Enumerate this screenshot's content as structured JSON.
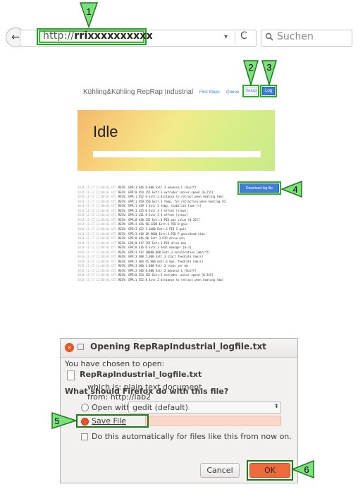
{
  "browser": {
    "url_prefix": "http://",
    "url_host": "rrixxxxxxxxxx",
    "search_placeholder": "Suchen",
    "back_glyph": "←",
    "forward_glyph": "⓪",
    "dropdown_glyph": "▾",
    "reload_glyph": "C",
    "search_glyph": "🔍"
  },
  "app": {
    "brand": "Kühling&Kühling RepRap Industrial",
    "nav": {
      "first_steps": "First Steps",
      "queue": "Queue",
      "setup": "Setup",
      "log": "Log"
    },
    "status": "Idle",
    "download_button": "Download log file",
    "log_lines": [
      {
        "ts": "2014-11-17 12:00:01 UTC",
        "msg": "RECV: EPR:3 446 8.000 Extr.3 advance L [0=off]"
      },
      {
        "ts": "2014-11-17 12:00:01 UTC",
        "msg": "RECV: EPR:0 454 255 Extr.3 extruder cooler speed [0-255]"
      },
      {
        "ts": "2014-11-17 12:00:01 UTC",
        "msg": "RECV: EPR:1 452 8 Extr.3 distance to retract when heating [mm]"
      },
      {
        "ts": "2014-11-17 12:00:01 UTC",
        "msg": "RECV: EPR:1 450 150 Extr.3 temp. for retraction when heating [C]"
      },
      {
        "ts": "2014-11-17 12:00:01 UTC",
        "msg": "RECV: EPR:1 439 1 Extr.3 temp. stabilize time [s]"
      },
      {
        "ts": "2014-11-17 12:00:01 UTC",
        "msg": "RECV: EPR:1 435 0 Extr.3 Y-offset [steps]"
      },
      {
        "ts": "2014-11-17 12:00:01 UTC",
        "msg": "RECV: EPR:1 431 0 Extr.3 X-offset [steps]"
      },
      {
        "ts": "2014-11-17 12:00:01 UTC",
        "msg": "RECV: EPR:0 430 255 Extr.3 PID max value [0-255]"
      },
      {
        "ts": "2014-11-17 12:00:01 UTC",
        "msg": "RECV: EPR:3 426 50.3200 Extr.3 PID D-gain"
      },
      {
        "ts": "2014-11-17 12:00:01 UTC",
        "msg": "RECV: EPR:3 422 1.6400 Extr.3 PID I-gain"
      },
      {
        "ts": "2014-11-17 12:00:01 UTC",
        "msg": "RECV: EPR:3 418 19.9600 Extr.3 PID P-gain/dead-time"
      },
      {
        "ts": "2014-11-17 12:00:01 UTC",
        "msg": "RECV: EPR:0 446 60 Extr.3 PID drive min"
      },
      {
        "ts": "2014-11-17 12:00:01 UTC",
        "msg": "RECV: EPR:0 417 255 Extr.3 PID drive max"
      },
      {
        "ts": "2014-11-17 12:00:01 UTC",
        "msg": "RECV: EPR:0 416 0 Extr.3 heat manager [0-3]"
      },
      {
        "ts": "2014-11-17 12:00:01 UTC",
        "msg": "RECV: EPR:3 412 10000.000 Extr.3 acceleration [mm/s^2]"
      },
      {
        "ts": "2014-11-17 12:00:01 UTC",
        "msg": "RECV: EPR:3 408 5.000 Extr.3 start feedrate [mm/s]"
      },
      {
        "ts": "2014-11-17 12:00:01 UTC",
        "msg": "RECV: EPR:3 404 45.000 Extr.3 max. feedrate [mm/s]"
      },
      {
        "ts": "2014-11-17 12:00:01 UTC",
        "msg": "RECV: EPR:3 400 1.000 Extr.3 steps per mm"
      },
      {
        "ts": "2014-11-17 12:00:01 UTC",
        "msg": "RECV: EPR:3 346 8.000 Extr.2 advance L [0=off]"
      },
      {
        "ts": "2014-11-17 12:00:01 UTC",
        "msg": "RECV: EPR:0 354 255 Extr.2 extruder cooler speed [0-255]"
      },
      {
        "ts": "2014-11-17 12:00:01 UTC",
        "msg": "RECV: EPR:1 352 8 Extr.2 distance to retract when heating [mm]"
      }
    ]
  },
  "dialog": {
    "title": "Opening RepRapIndustrial_logfile.txt",
    "chosen_label": "You have chosen to open:",
    "filename": "RepRapIndustrial_logfile.txt",
    "which_is": "which is: plain text document",
    "from": "from: http://lab2",
    "question": "What should Firefox do with this file?",
    "open_with_label": "Open with",
    "open_with_app": "gedit (default)",
    "save_file_label": "Save File",
    "auto_label": "Do this automatically for files like this from now on.",
    "cancel_label": "Cancel",
    "ok_label": "OK"
  },
  "callouts": [
    "1",
    "2",
    "3",
    "4",
    "5",
    "6"
  ],
  "colors": {
    "callout_fill": "#7ce17c",
    "callout_border": "#1c7a1c",
    "accent_orange": "#ec6a3c",
    "link_blue": "#3a7bd5",
    "download_blue": "#3f7fd5"
  }
}
